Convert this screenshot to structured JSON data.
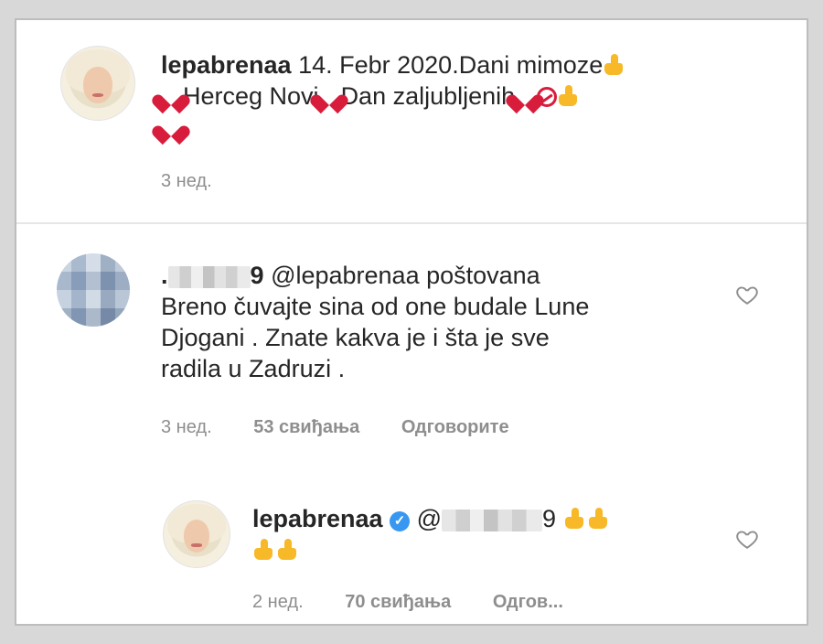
{
  "post": {
    "username": "lepabrenaa",
    "caption_line1": " 14. Febr 2020.Dani mimoze",
    "caption_line2_a": "Herceg Novi",
    "caption_line2_b": "Dan zaljubljenih",
    "time": "3 нед."
  },
  "comment": {
    "username_masked": ".",
    "username_suffix": "9",
    "mention": "@lepabrenaa",
    "text_line1": " poštovana",
    "text_line2": "Breno čuvajte sina od one budale Lune",
    "text_line3": "Djogani . Znate kakva je i šta je sve",
    "text_line4": "radila u Zadruzi .",
    "time": "3 нед.",
    "likes": "53 свиђања",
    "reply": "Одговорите"
  },
  "reply": {
    "username": "lepabrenaa",
    "verified_glyph": "✓",
    "mention_prefix": "@",
    "mention_suffix": "9",
    "time": "2 нед.",
    "likes": "70 свиђања",
    "reply": "Одгов..."
  },
  "colors": {
    "text": "#262626",
    "meta": "#8e8e8e",
    "heart": "#d81c3c",
    "thumb": "#f7b928",
    "verified": "#3897f0"
  },
  "icons": {
    "like_outline": "heart-outline-icon",
    "thumbs_up": "thumbs-up-emoji",
    "red_heart": "red-heart-emoji"
  }
}
